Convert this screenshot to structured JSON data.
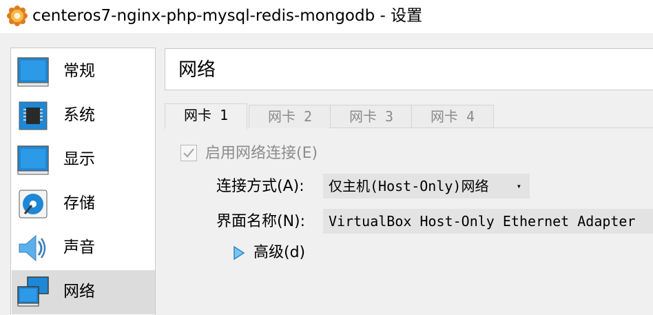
{
  "window": {
    "title": "centeros7-nginx-php-mysql-redis-mongodb - 设置"
  },
  "sidebar": {
    "items": [
      {
        "label": "常规",
        "icon": "monitor-icon"
      },
      {
        "label": "系统",
        "icon": "chip-icon"
      },
      {
        "label": "显示",
        "icon": "display-icon"
      },
      {
        "label": "存储",
        "icon": "disk-icon"
      },
      {
        "label": "声音",
        "icon": "speaker-icon"
      },
      {
        "label": "网络",
        "icon": "network-icon"
      }
    ],
    "selected": "网络"
  },
  "header": {
    "title": "网络"
  },
  "tabs": [
    {
      "label": "网卡 1",
      "active": true
    },
    {
      "label": "网卡 2",
      "active": false
    },
    {
      "label": "网卡 3",
      "active": false
    },
    {
      "label": "网卡 4",
      "active": false
    }
  ],
  "adapter": {
    "enable_label": "启用网络连接(E)",
    "attached_label": "连接方式(A):",
    "attached_value": "仅主机(Host-Only)网络",
    "name_label": "界面名称(N):",
    "name_value": "VirtualBox Host-Only Ethernet Adapter",
    "advanced_label": "高级(d)"
  },
  "colors": {
    "accent_blue": "#1e88d6",
    "selected_row": "#dcdcdc",
    "field_bg": "#e3e3e3"
  }
}
